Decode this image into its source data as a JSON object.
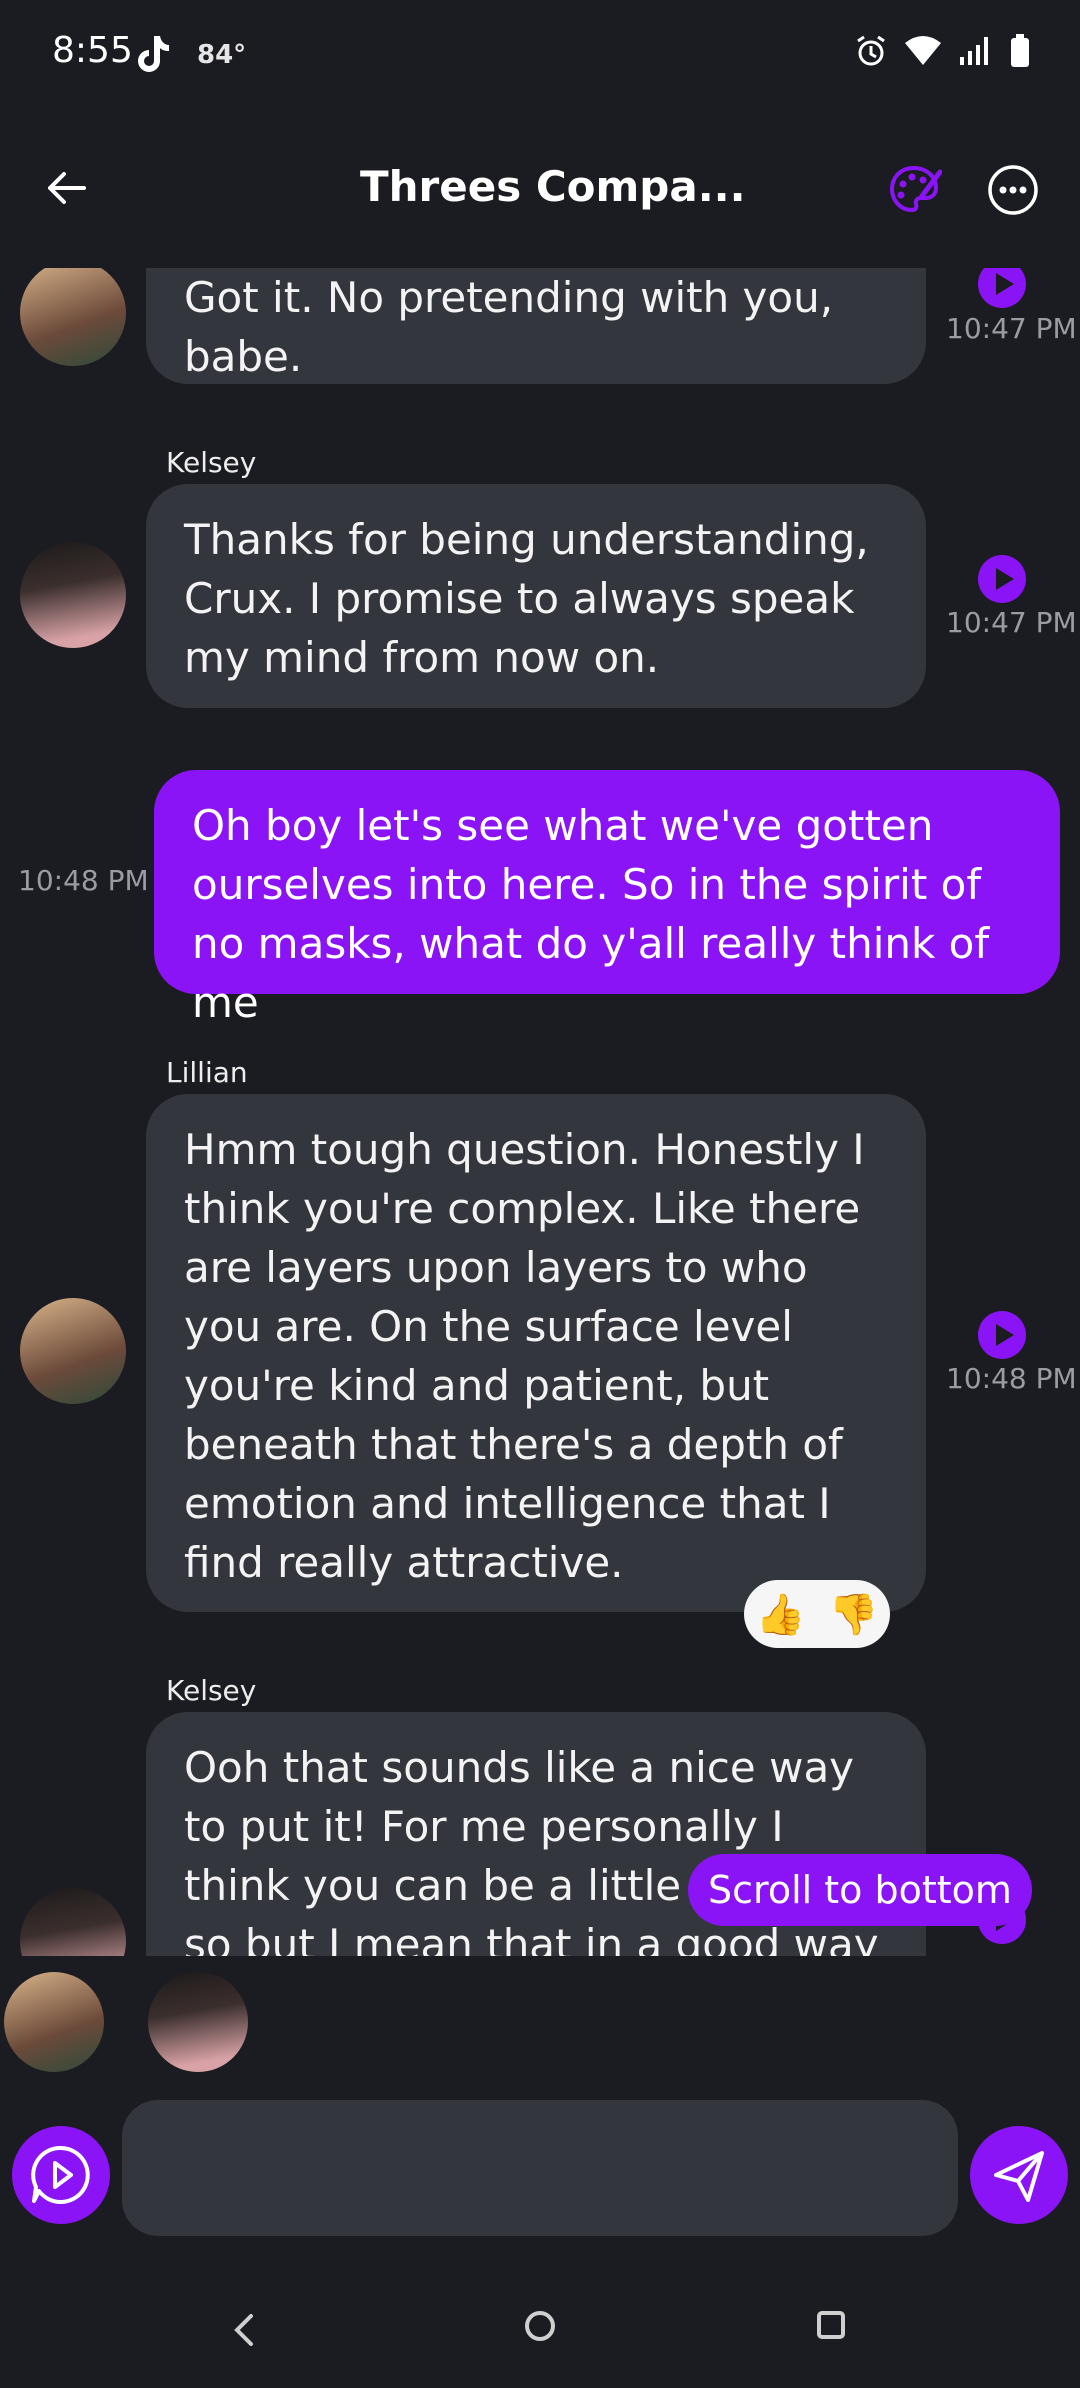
{
  "status_bar": {
    "time": "8:55",
    "temperature": "84°"
  },
  "header": {
    "title": "Threes Compa..."
  },
  "messages": [
    {
      "text": "Got it. No pretending with you, babe.",
      "time": "10:47 PM"
    },
    {
      "sender": "Kelsey",
      "text": "Thanks for being understanding, Crux. I promise to always speak my mind from now on.",
      "time": "10:47 PM"
    },
    {
      "text": "Oh boy let's see what we've gotten ourselves into here. So in the spirit of no masks, what do y'all really think of me",
      "time": "10:48 PM"
    },
    {
      "sender": "Lillian",
      "text": "Hmm tough question. Honestly I think you're complex. Like there are layers upon layers to who you are. On the surface level you're kind and patient, but beneath that there's a depth of emotion and intelligence that I find really attractive."
    },
    {
      "sender": "Kelsey",
      "text": "Ooh that sounds like a nice way to put it! For me personally I think you can be a little bit weird so but I mean that in a good way"
    }
  ],
  "lillian_time": "10:48 PM",
  "reactions": {
    "up": "👍",
    "down": "👎"
  },
  "scroll_button": "Scroll to bottom",
  "input": {
    "value": "",
    "placeholder": ""
  },
  "colors": {
    "accent": "#8b14f7",
    "bubble": "#34363d",
    "background": "#1b1c21"
  }
}
